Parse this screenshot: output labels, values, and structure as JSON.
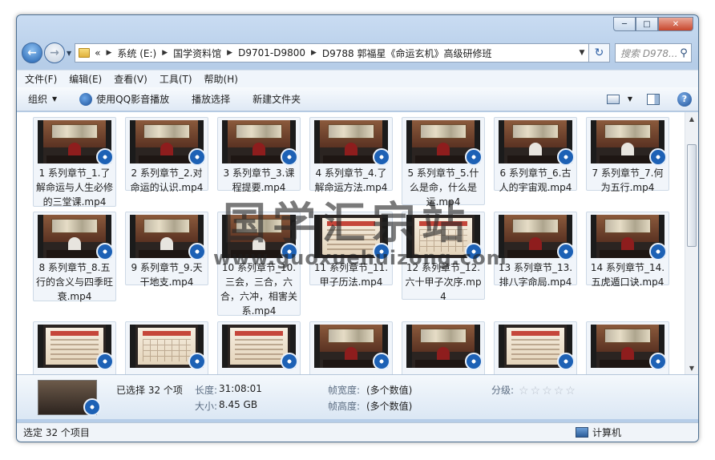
{
  "window": {
    "minimize": "─",
    "maximize": "□",
    "close": "✕"
  },
  "address": {
    "recent_marker": "«",
    "crumbs": [
      "系统 (E:)",
      "国学资料馆",
      "D9701-D9800",
      "D9788 郭福星《命运玄机》高级研修班"
    ]
  },
  "search": {
    "placeholder": "搜索 D978..."
  },
  "menu": [
    "文件(F)",
    "编辑(E)",
    "查看(V)",
    "工具(T)",
    "帮助(H)"
  ],
  "toolbar": {
    "organize": "组织",
    "play_qq": "使用QQ影音播放",
    "playlist": "播放选择",
    "new_folder": "新建文件夹"
  },
  "files": [
    {
      "name": "1 系列章节_1.了解命运与人生必修的三堂课.mp4",
      "thumb": "lecture-red"
    },
    {
      "name": "2 系列章节_2.对命运的认识.mp4",
      "thumb": "lecture-red"
    },
    {
      "name": "3 系列章节_3.课程提要.mp4",
      "thumb": "lecture-red"
    },
    {
      "name": "4 系列章节_4.了解命运方法.mp4",
      "thumb": "lecture-red"
    },
    {
      "name": "5 系列章节_5.什么是命，什么是运.mp4",
      "thumb": "lecture-red"
    },
    {
      "name": "6 系列章节_6.古人的宇宙观.mp4",
      "thumb": "lecture-white"
    },
    {
      "name": "7 系列章节_7.何为五行.mp4",
      "thumb": "lecture-white"
    },
    {
      "name": "8 系列章节_8.五行的含义与四季旺衰.mp4",
      "thumb": "lecture-white"
    },
    {
      "name": "9 系列章节_9.天干地支.mp4",
      "thumb": "lecture-white"
    },
    {
      "name": "10 系列章节_10.三会，三合，六合，六冲，相害关系.mp4",
      "thumb": "lecture-white"
    },
    {
      "name": "11 系列章节_11.甲子历法.mp4",
      "thumb": "slide"
    },
    {
      "name": "12 系列章节_12.六十甲子次序.mp4",
      "thumb": "slide-table"
    },
    {
      "name": "13 系列章节_13.排八字命局.mp4",
      "thumb": "lecture-red"
    },
    {
      "name": "14 系列章节_14.五虎遁口诀.mp4",
      "thumb": "lecture-red"
    },
    {
      "name": "",
      "thumb": "slide"
    },
    {
      "name": "",
      "thumb": "slide-table"
    },
    {
      "name": "",
      "thumb": "slide"
    },
    {
      "name": "",
      "thumb": "lecture-red"
    },
    {
      "name": "",
      "thumb": "lecture-red"
    },
    {
      "name": "",
      "thumb": "slide"
    },
    {
      "name": "",
      "thumb": "lecture-red"
    }
  ],
  "watermark": {
    "title": "国学汇宗站",
    "url": "www.guoxuehuizong.com"
  },
  "details": {
    "selected": "已选择 32 个项",
    "length_label": "长度:",
    "length_value": "31:08:01",
    "size_label": "大小:",
    "size_value": "8.45 GB",
    "frame_width_label": "帧宽度:",
    "frame_width_value": "(多个数值)",
    "frame_height_label": "帧高度:",
    "frame_height_value": "(多个数值)",
    "rating_label": "分级:",
    "rating_stars": 5
  },
  "status": {
    "left": "选定 32 个项目",
    "right": "计算机"
  }
}
